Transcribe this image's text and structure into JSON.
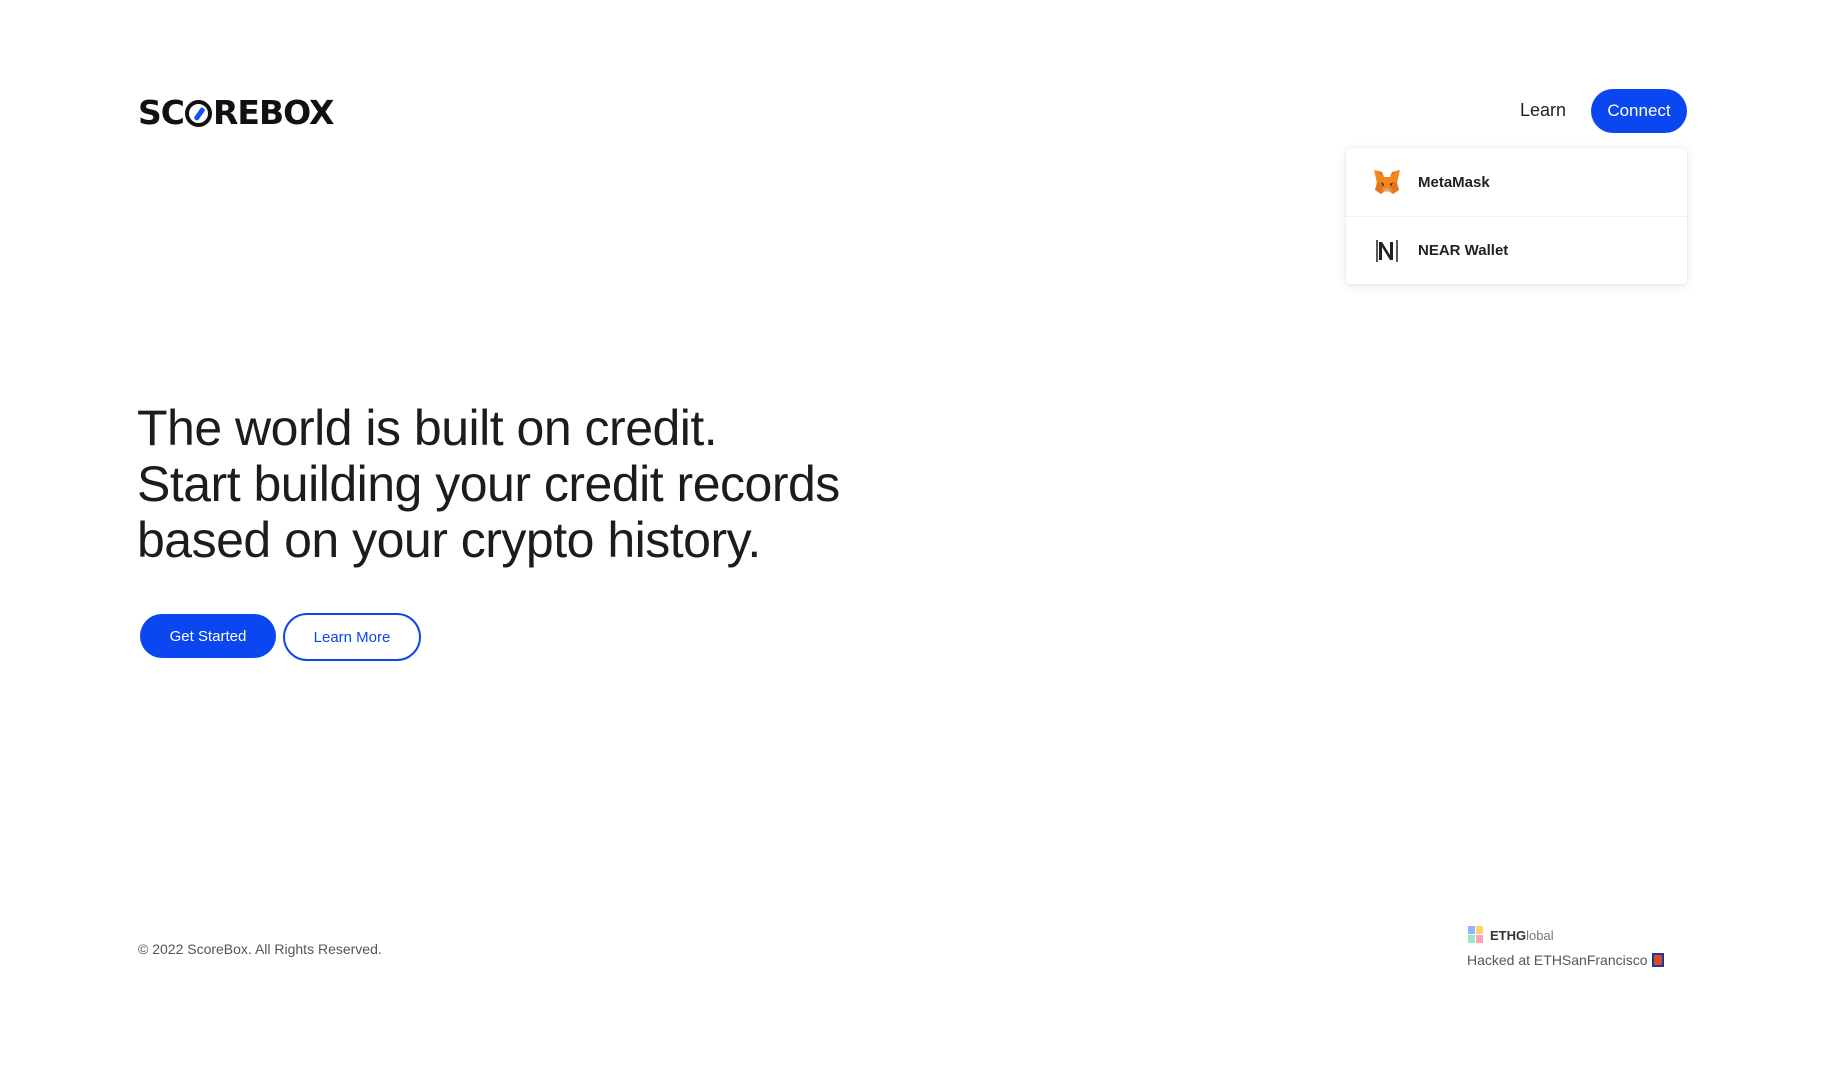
{
  "header": {
    "logo_text_before": "SC",
    "logo_text_after": "REBOX",
    "nav_learn": "Learn",
    "connect_label": "Connect"
  },
  "wallet_menu": {
    "items": [
      {
        "label": "MetaMask",
        "icon": "metamask-fox-icon"
      },
      {
        "label": "NEAR Wallet",
        "icon": "near-logo-icon"
      }
    ]
  },
  "hero": {
    "line1": "The world is built on credit.",
    "line2": "Start building your credit records",
    "line3": "based on your crypto history.",
    "get_started_label": "Get Started",
    "learn_more_label": "Learn More"
  },
  "footer": {
    "copyright": "© 2022 ScoreBox. All Rights Reserved.",
    "ethglobal_bold": "ETHG",
    "ethglobal_light": "lobal",
    "hacked_at": "Hacked at ETHSanFrancisco"
  },
  "colors": {
    "accent": "#0a47f0",
    "text": "#1c1c1c",
    "background": "#ffffff"
  }
}
